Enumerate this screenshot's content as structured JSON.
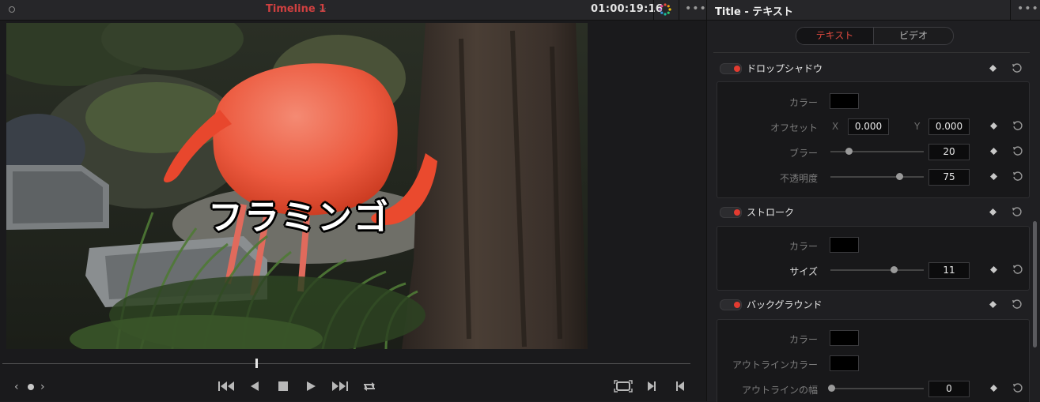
{
  "viewer": {
    "timeline_name": "Timeline 1",
    "timecode": "01:00:19:16",
    "title_overlay": "フラミンゴ"
  },
  "inspector": {
    "title": "Title - テキスト",
    "tabs": [
      "テキスト",
      "ビデオ"
    ],
    "active_tab": "テキスト",
    "drop_shadow": {
      "label": "ドロップシャドウ",
      "color_label": "カラー",
      "offset_label": "オフセット",
      "offset_x_axis": "X",
      "offset_x": "0.000",
      "offset_y_axis": "Y",
      "offset_y": "0.000",
      "blur_label": "ブラー",
      "blur": "20",
      "opacity_label": "不透明度",
      "opacity": "75"
    },
    "stroke": {
      "label": "ストローク",
      "color_label": "カラー",
      "size_label": "サイズ",
      "size": "11"
    },
    "background": {
      "label": "バックグラウンド",
      "color_label": "カラー",
      "outline_color_label": "アウトラインカラー",
      "outline_width_label": "アウトラインの幅",
      "outline_width": "0"
    }
  },
  "colors": {
    "accent_red": "#e23b30",
    "timeline_title": "#d04040"
  },
  "icons": {
    "header": [
      "chevron-down-icon",
      "color-wheel-icon",
      "more-icon"
    ],
    "transport": [
      "skip-back-icon",
      "play-reverse-icon",
      "stop-icon",
      "play-icon",
      "skip-forward-icon",
      "loop-icon"
    ],
    "right_controls": [
      "fullscreen-icon",
      "next-frame-icon",
      "prev-frame-icon"
    ],
    "rows": [
      "keyframe-icon",
      "reset-icon"
    ]
  }
}
